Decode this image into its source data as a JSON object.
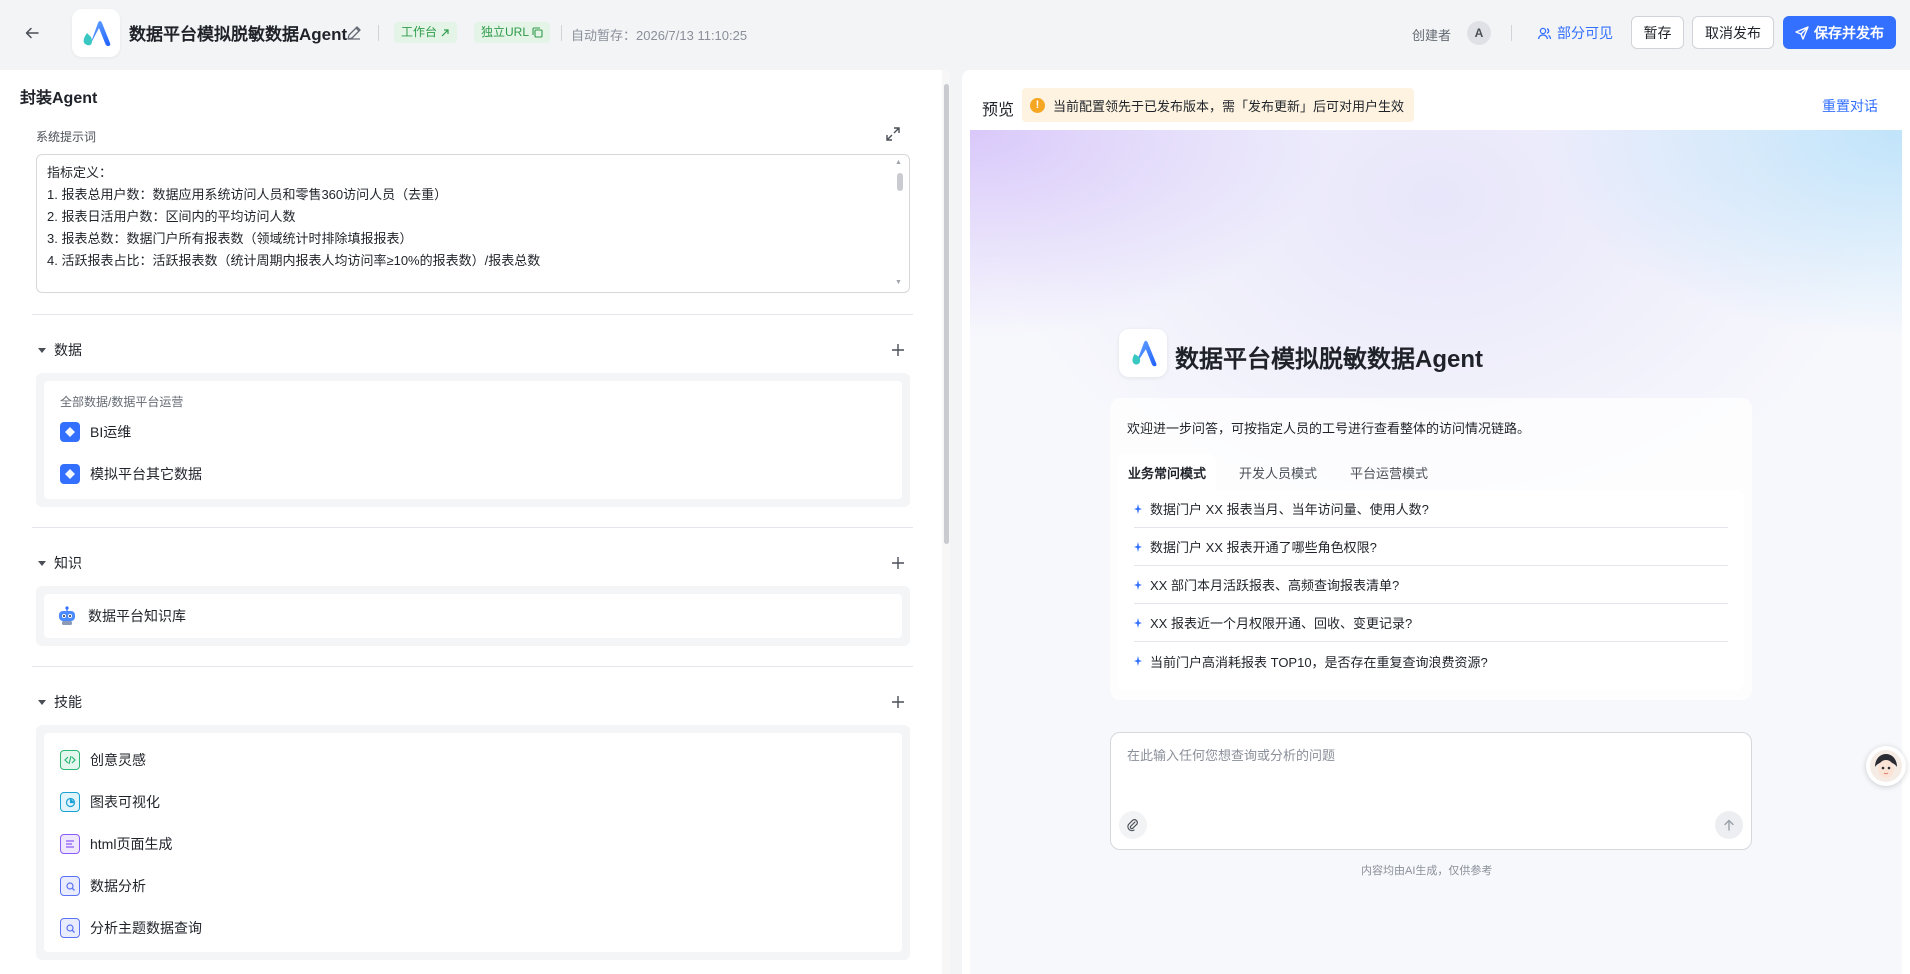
{
  "header": {
    "app_title": "数据平台模拟脱敏数据Agent",
    "tag_workspace": "工作台",
    "tag_url": "独立URL",
    "autosave": "自动暂存：2026/7/13 11:10:25",
    "creator_label": "创建者",
    "creator_initial": "A",
    "visibility": "部分可见",
    "save_draft": "暂存",
    "unpublish": "取消发布",
    "save_publish": "保存并发布"
  },
  "left": {
    "panel_title": "封装Agent",
    "system_prompt_label": "系统提示词",
    "system_prompt_lines": [
      "指标定义：",
      "1. 报表总用户数：数据应用系统访问人员和零售360访问人员（去重）",
      "2. 报表日活用户数：区间内的平均访问人数",
      "3. 报表总数：数据门户所有报表数（领域统计时排除填报报表）",
      "4. 活跃报表占比：活跃报表数（统计周期内报表人均访问率≥10%的报表数）/报表总数"
    ],
    "data_section": {
      "title": "数据",
      "path": "全部数据/数据平台运营",
      "items": [
        "BI运维",
        "模拟平台其它数据"
      ]
    },
    "knowledge_section": {
      "title": "知识",
      "items": [
        "数据平台知识库"
      ]
    },
    "skills_section": {
      "title": "技能",
      "items": [
        "创意灵感",
        "图表可视化",
        "html页面生成",
        "数据分析",
        "分析主题数据查询"
      ]
    }
  },
  "right": {
    "preview_label": "预览",
    "notice": "当前配置领先于已发布版本，需「发布更新」后可对用户生效",
    "reset": "重置对话",
    "agent_title": "数据平台模拟脱敏数据Agent",
    "welcome": "欢迎进一步问答，可按指定人员的工号进行查看整体的访问情况链路。",
    "tabs": [
      "业务常问模式",
      "开发人员模式",
      "平台运营模式"
    ],
    "questions": [
      "数据门户 XX 报表当月、当年访问量、使用人数?",
      "数据门户 XX 报表开通了哪些角色权限?",
      "XX 部门本月活跃报表、高频查询报表清单?",
      "XX 报表近一个月权限开通、回收、变更记录?",
      "当前门户高消耗报表 TOP10，是否存在重复查询浪费资源?"
    ],
    "input_placeholder": "在此输入任何您想查询或分析的问题",
    "disclaimer": "内容均由AI生成，仅供参考"
  },
  "colors": {
    "accent": "#3370ff",
    "tag_green": "#2f9a4a",
    "warning": "#f5a623"
  },
  "icons": {
    "back": "arrow-left-icon",
    "edit": "pencil-icon",
    "expand": "expand-icon",
    "add": "plus-icon",
    "send": "arrow-up-icon",
    "attach": "attachment-icon"
  }
}
